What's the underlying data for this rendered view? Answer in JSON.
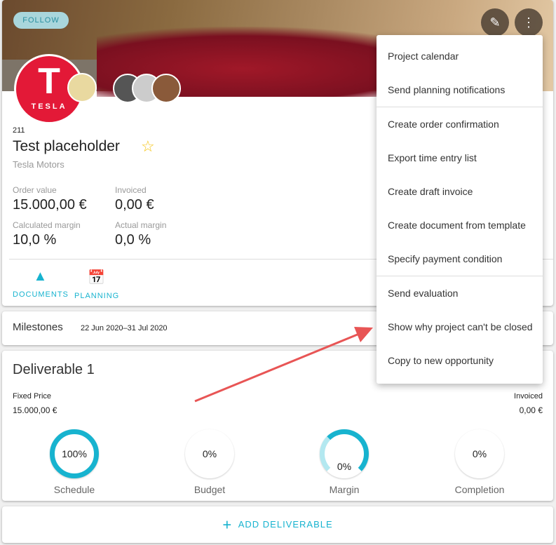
{
  "header": {
    "follow_label": "FOLLOW",
    "edit_icon": "pencil-icon",
    "more_icon": "more-vert-icon",
    "logo_text": "TESLA"
  },
  "project": {
    "number": "211",
    "title": "Test placeholder",
    "company": "Tesla Motors",
    "starred": false
  },
  "stats": {
    "order_value_label": "Order value",
    "order_value": "15.000,00 €",
    "invoiced_label": "Invoiced",
    "invoiced": "0,00 €",
    "calc_margin_label": "Calculated margin",
    "calc_margin": "10,0 %",
    "actual_margin_label": "Actual margin",
    "actual_margin": "0,0 %"
  },
  "actions": {
    "documents": "DOCUMENTS",
    "planning": "PLANNING"
  },
  "milestones": {
    "title": "Milestones",
    "range": "22 Jun 2020–31 Jul 2020"
  },
  "deliverable": {
    "title": "Deliverable 1",
    "type_label": "Fixed Price",
    "type_value": "15.000,00 €",
    "invoiced_label": "Invoiced",
    "invoiced_value": "0,00 €",
    "gauges": [
      {
        "label": "Schedule",
        "value": "100%",
        "percent": 100
      },
      {
        "label": "Budget",
        "value": "0%",
        "percent": 0
      },
      {
        "label": "Margin",
        "value": "0%",
        "percent": 0
      },
      {
        "label": "Completion",
        "value": "0%",
        "percent": 0
      }
    ]
  },
  "add_deliverable": "ADD DELIVERABLE",
  "menu": {
    "items": [
      "Project calendar",
      "Send planning notifications",
      "Create order confirmation",
      "Export time entry list",
      "Create draft invoice",
      "Create document from template",
      "Specify payment condition",
      "Send evaluation",
      "Show why project can't be closed",
      "Copy to new opportunity"
    ]
  },
  "colors": {
    "accent": "#17b3cf",
    "arrow": "#e85555",
    "star": "#f5c518",
    "tesla": "#e31937"
  }
}
